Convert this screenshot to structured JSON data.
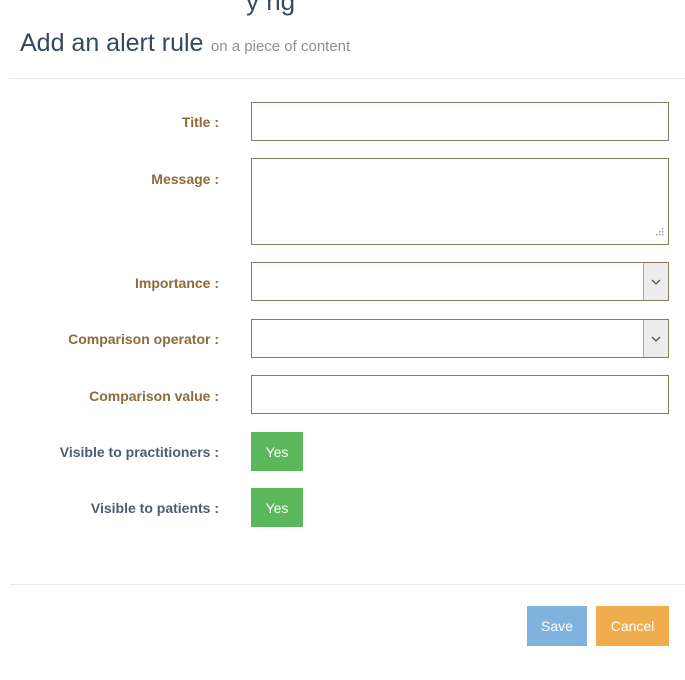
{
  "page": {
    "top_partial_text": "y   ng",
    "title": "Add an alert rule",
    "subtitle": "on a piece of content"
  },
  "form": {
    "title_label": "Title :",
    "title_value": "",
    "message_label": "Message :",
    "message_value": "",
    "importance_label": "Importance :",
    "importance_value": "",
    "comparison_operator_label": "Comparison operator :",
    "comparison_operator_value": "",
    "comparison_value_label": "Comparison value :",
    "comparison_value_value": "",
    "visible_practitioners_label": "Visible to practitioners :",
    "visible_practitioners_value": "Yes",
    "visible_patients_label": "Visible to patients :",
    "visible_patients_value": "Yes"
  },
  "footer": {
    "save_label": "Save",
    "cancel_label": "Cancel"
  },
  "colors": {
    "label_gold": "#8c6a3b",
    "label_slate": "#4a5d73",
    "toggle_green": "#5cb85c",
    "save_blue": "#7fb2dd",
    "cancel_orange": "#f0ad4e"
  },
  "icons": {
    "select_arrow": "chevron-down-icon",
    "resize_handle": "resize-grip-icon"
  }
}
